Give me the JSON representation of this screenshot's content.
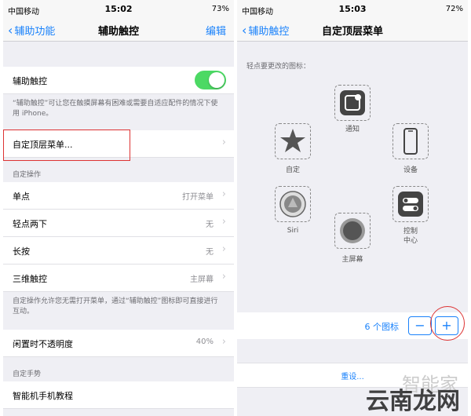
{
  "left": {
    "status": {
      "carrier": "中国移动",
      "time": "15:02",
      "battery": "73%"
    },
    "nav": {
      "back": "辅助功能",
      "title": "辅助触控",
      "action": "编辑"
    },
    "toggle_label": "辅助触控",
    "toggle_on": true,
    "toggle_note": "“辅助触控”可让您在触摸屏幕有困难或需要自适应配件的情况下使用 iPhone。",
    "top_menu": "自定顶层菜单...",
    "custom_actions_header": "自定操作",
    "actions": [
      {
        "label": "单点",
        "value": "打开菜单"
      },
      {
        "label": "轻点两下",
        "value": "无"
      },
      {
        "label": "长按",
        "value": "无"
      },
      {
        "label": "三维触控",
        "value": "主屏幕"
      }
    ],
    "actions_note": "自定操作允许您无需打开菜单，通过“辅助触控”图标即可直接进行互动。",
    "idle_opacity": {
      "label": "闲置时不透明度",
      "value": "40%"
    },
    "gestures_header": "自定手势",
    "tutorial": "智能机手机教程"
  },
  "right": {
    "status": {
      "carrier": "中国移动",
      "time": "15:03",
      "battery": "72%"
    },
    "nav": {
      "back": "辅助触控",
      "title": "自定顶层菜单"
    },
    "hint": "轻点要更改的图标：",
    "icons": {
      "notification": "通知",
      "custom": "自定",
      "device": "设备",
      "siri": "Siri",
      "home": "主屏幕",
      "control": "控制\n中心"
    },
    "count": "6 个图标",
    "minus": "−",
    "plus": "+",
    "reset": "重设...",
    "watermark_top": "智能家",
    "watermark": "云南龙网"
  }
}
